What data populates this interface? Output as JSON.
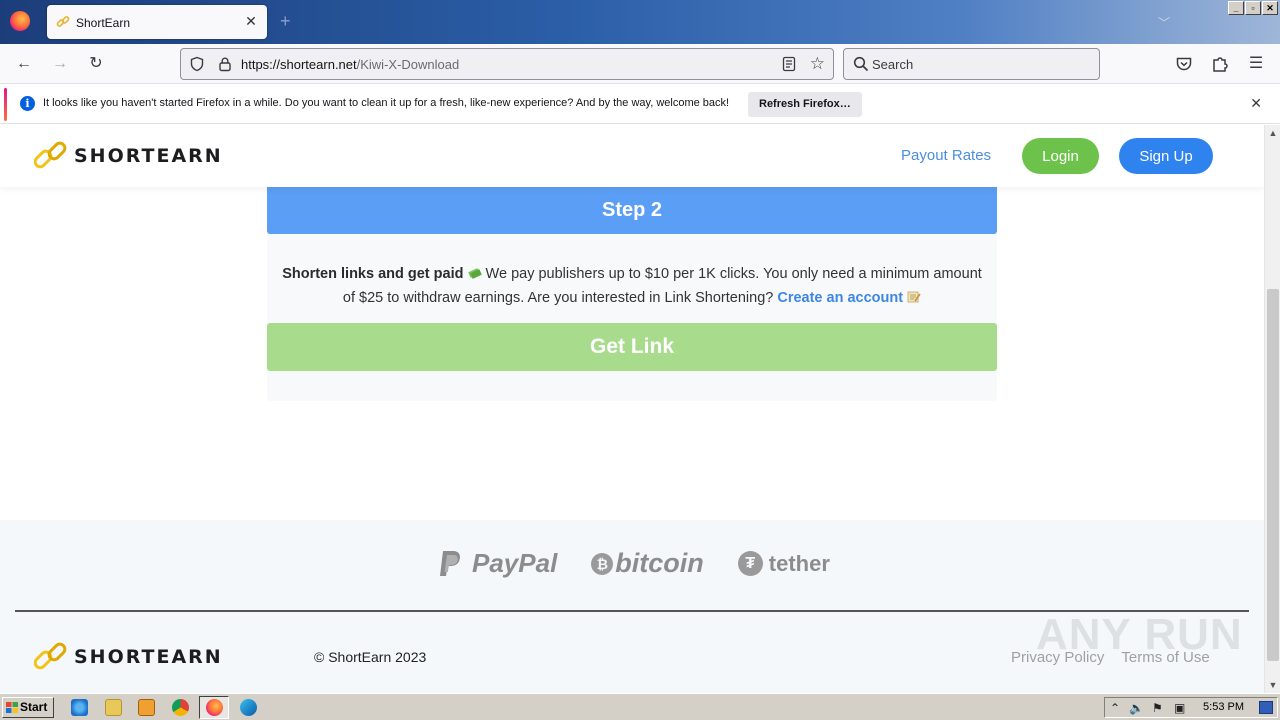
{
  "browser": {
    "tab_title": "ShortEarn",
    "url_host": "https://shortearn.net",
    "url_path": "/Kiwi-X-Download",
    "search_placeholder": "Search",
    "notification": {
      "message": "It looks like you haven't started Firefox in a while. Do you want to clean it up for a fresh, like-new experience? And by the way, welcome back!",
      "button": "Refresh Firefox…"
    }
  },
  "site": {
    "brand": "SHORTEARN",
    "nav": {
      "payout": "Payout Rates",
      "login": "Login",
      "signup": "Sign Up"
    },
    "step_title": "Step 2",
    "promo": {
      "bold": "Shorten links and get paid",
      "text": "We pay publishers up to $10 per 1K clicks. You only need a minimum amount of $25 to withdraw earnings. Are you interested in Link Shortening?",
      "link": "Create an account"
    },
    "get_link": "Get Link",
    "payments": {
      "paypal": "PayPal",
      "bitcoin": "bitcoin",
      "tether": "tether"
    },
    "footer": {
      "copyright": "© ShortEarn 2023",
      "privacy": "Privacy Policy",
      "terms": "Terms of Use"
    }
  },
  "watermark": "ANY RUN",
  "taskbar": {
    "start": "Start",
    "clock": "5:53 PM"
  },
  "colors": {
    "step_blue": "#5b9ef5",
    "login_green": "#6cc24a",
    "signup_blue": "#2f83ee",
    "get_link_green": "#a8dc8c"
  }
}
